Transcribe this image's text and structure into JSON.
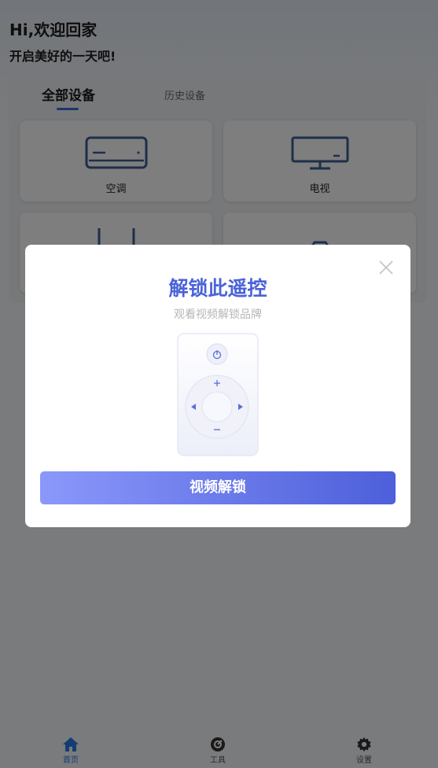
{
  "greeting": {
    "title": "Hi,欢迎回家",
    "subtitle": "开启美好的一天吧!"
  },
  "device_tabs": {
    "all": "全部设备",
    "history": "历史设备"
  },
  "devices": [
    {
      "label": "空调",
      "icon": "air-conditioner-icon"
    },
    {
      "label": "电视",
      "icon": "tv-icon"
    },
    {
      "label": "",
      "icon": "router-icon"
    },
    {
      "label": "",
      "icon": "camera-icon"
    }
  ],
  "modal": {
    "title": "解锁此遥控",
    "subtitle": "观看视频解锁品牌",
    "button_label": "视频解锁",
    "close_icon": "close-icon",
    "image_icon": "remote-control-icon"
  },
  "tabbar": {
    "items": [
      {
        "label": "首页",
        "icon": "home-icon",
        "active": true
      },
      {
        "label": "工具",
        "icon": "tool-icon",
        "active": false
      },
      {
        "label": "设置",
        "icon": "gear-icon",
        "active": false
      }
    ]
  },
  "colors": {
    "accent": "#4a63d8",
    "button_start": "#8b98fb",
    "button_end": "#4d5fda",
    "tab_active": "#2a78e4"
  }
}
